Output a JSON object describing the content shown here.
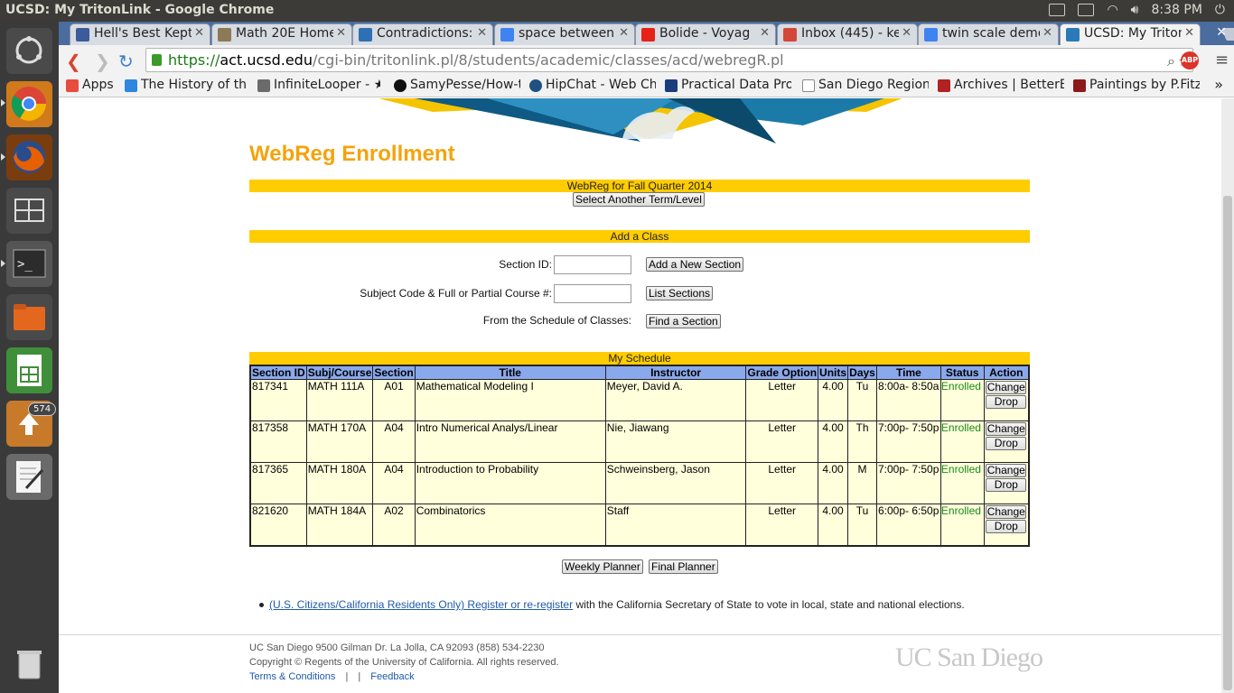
{
  "os": {
    "window_title": "UCSD: My TritonLink - Google Chrome",
    "clock": "8:38 PM",
    "launcher_badge": "574"
  },
  "tabs": [
    {
      "label": "Hell's Best Kept",
      "favicon_color": "#3b5b9b",
      "active": false
    },
    {
      "label": "Math 20E Home",
      "favicon_color": "#8b7a55",
      "active": false
    },
    {
      "label": "Contradictions:",
      "favicon_color": "#2f6fb3",
      "active": false
    },
    {
      "label": "space between",
      "favicon_color": "#3f83f0",
      "active": false
    },
    {
      "label": "Bolide - Voyag",
      "favicon_color": "#e62117",
      "active": false
    },
    {
      "label": "Inbox (445) - ke",
      "favicon_color": "#d44638",
      "active": false
    },
    {
      "label": "twin scale demo",
      "favicon_color": "#3f83f0",
      "active": false
    },
    {
      "label": "UCSD: My Triton",
      "favicon_color": "#2a7ab8",
      "active": true
    }
  ],
  "address": {
    "scheme": "https://",
    "host": "act.ucsd.edu",
    "path": "/cgi-bin/tritonlink.pl/8/students/academic/classes/acd/webregR.pl"
  },
  "bookmarks": [
    {
      "label": "Apps",
      "icon_color": "#e74c3c"
    },
    {
      "label": "The History of the",
      "icon_color": "#2e86de"
    },
    {
      "label": "InfiniteLooper - ★",
      "icon_color": "#6b6b6b"
    },
    {
      "label": "SamyPesse/How-t",
      "icon_color": "#111111"
    },
    {
      "label": "HipChat - Web Cha",
      "icon_color": "#205081"
    },
    {
      "label": "Practical Data Prog",
      "icon_color": "#1a3d7c"
    },
    {
      "label": "San Diego Regiona",
      "icon_color": "#888888"
    },
    {
      "label": "Archives | BetterE",
      "icon_color": "#b22222"
    },
    {
      "label": "Paintings by P.Fitz",
      "icon_color": "#8b1a1a"
    }
  ],
  "page": {
    "title": "WebReg Enrollment",
    "term_bar": "WebReg for Fall Quarter 2014",
    "select_term_button": "Select Another Term/Level",
    "add_class_bar": "Add a Class",
    "section_id_label": "Section ID:",
    "section_id_value": "",
    "add_section_button": "Add a New Section",
    "subject_label": "Subject Code & Full or Partial Course #:",
    "subject_value": "",
    "list_sections_button": "List Sections",
    "schedule_of_classes_label": "From the Schedule of Classes:",
    "find_section_button": "Find a Section",
    "schedule_bar": "My Schedule",
    "weekly_planner_button": "Weekly Planner",
    "final_planner_button": "Final Planner",
    "voter_link": "(U.S. Citizens/California Residents Only) Register or re-register",
    "voter_text": " with the California Secretary of State to vote in local, state and national elections."
  },
  "schedule": {
    "columns": [
      "Section ID",
      "Subj/Course",
      "Section",
      "Title",
      "Instructor",
      "Grade Option",
      "Units",
      "Days",
      "Time",
      "Status",
      "Action"
    ],
    "change_label": "Change",
    "drop_label": "Drop",
    "rows": [
      {
        "section_id": "817341",
        "course": "MATH 111A",
        "section": "A01",
        "title": "Mathematical Modeling I",
        "instructor": "Meyer, David A.",
        "grade_option": "Letter",
        "units": "4.00",
        "days": "Tu",
        "time": "8:00a- 8:50a",
        "status": "Enrolled"
      },
      {
        "section_id": "817358",
        "course": "MATH 170A",
        "section": "A04",
        "title": "Intro Numerical Analys/Linear",
        "instructor": "Nie, Jiawang",
        "grade_option": "Letter",
        "units": "4.00",
        "days": "Th",
        "time": "7:00p- 7:50p",
        "status": "Enrolled"
      },
      {
        "section_id": "817365",
        "course": "MATH 180A",
        "section": "A04",
        "title": "Introduction to Probability",
        "instructor": "Schweinsberg, Jason",
        "grade_option": "Letter",
        "units": "4.00",
        "days": "M",
        "time": "7:00p- 7:50p",
        "status": "Enrolled"
      },
      {
        "section_id": "821620",
        "course": "MATH 184A",
        "section": "A02",
        "title": "Combinatorics",
        "instructor": "Staff",
        "grade_option": "Letter",
        "units": "4.00",
        "days": "Tu",
        "time": "6:00p- 6:50p",
        "status": "Enrolled"
      }
    ]
  },
  "footer": {
    "address": "UC San Diego 9500 Gilman Dr. La Jolla, CA 92093 (858) 534-2230",
    "copyright": "Copyright © Regents of the University of California. All rights reserved.",
    "terms_link": "Terms & Conditions",
    "separator": "|",
    "feedback_link": "Feedback",
    "logo_text": "UC San Diego"
  },
  "colors": {
    "accent_gold": "#ffcc00",
    "title_orange": "#f5a30b",
    "header_blue": "#8aa8ec",
    "row_cream": "#ffffdc",
    "enrolled_green": "#1a8a1a"
  }
}
